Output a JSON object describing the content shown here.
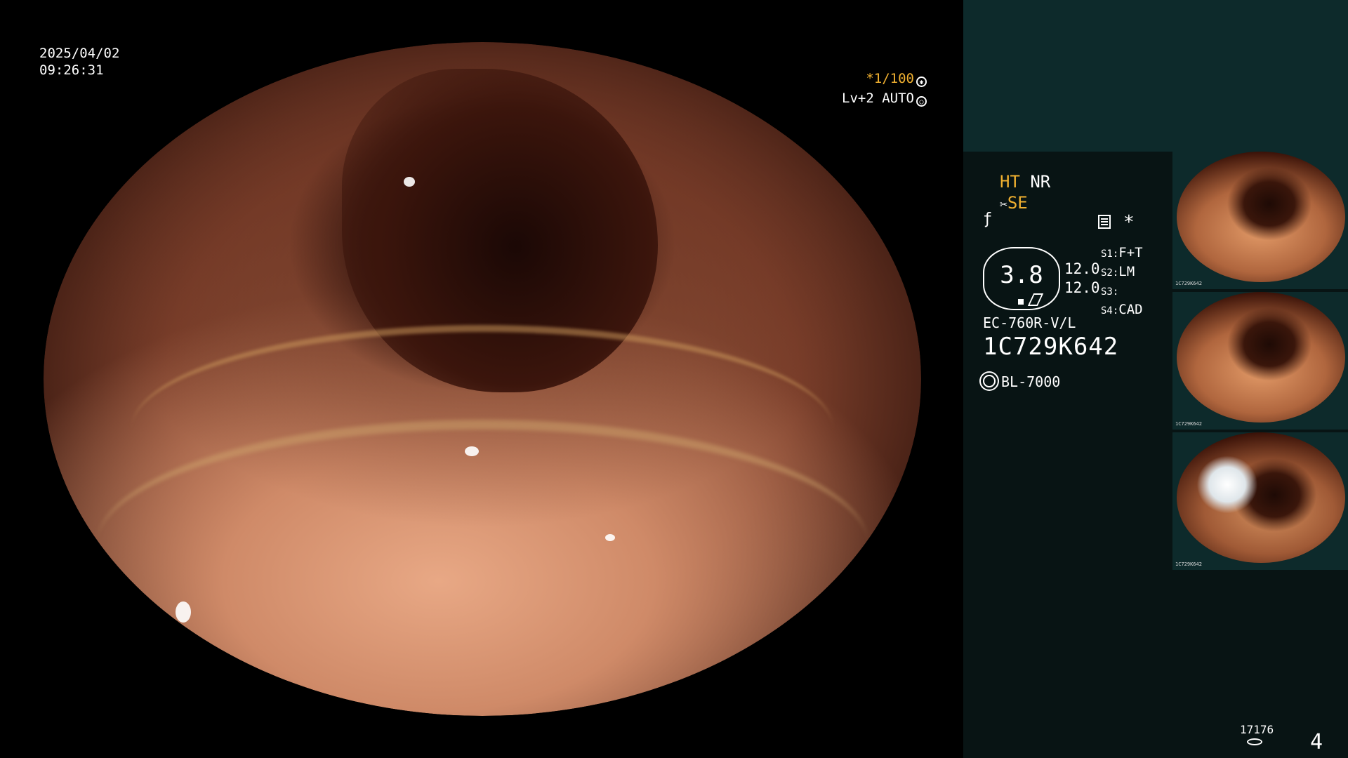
{
  "date": "2025/04/02",
  "time": "09:26:31",
  "shutter": "*1/100",
  "level": "Lv+2 AUTO",
  "modes": {
    "ht": "HT",
    "nr": "NR",
    "se": "SE"
  },
  "focus_value": "3.8",
  "values": [
    "12.0",
    "12.0"
  ],
  "switches": [
    {
      "key": "S1:",
      "val": "F+T"
    },
    {
      "key": "S2:",
      "val": "LM"
    },
    {
      "key": "S3:",
      "val": ""
    },
    {
      "key": "S4:",
      "val": "CAD"
    }
  ],
  "model": "EC-760R-V/L",
  "serial": "1C729K642",
  "lamp": "BL-7000",
  "thumbs": [
    {
      "label": "1C729K642"
    },
    {
      "label": "1C729K642"
    },
    {
      "label": "1C729K642"
    }
  ],
  "counter": "17176",
  "page_number": "4",
  "colors": {
    "accent": "#f0b030",
    "panel": "#081414",
    "panel_top": "#0d2a2b"
  }
}
